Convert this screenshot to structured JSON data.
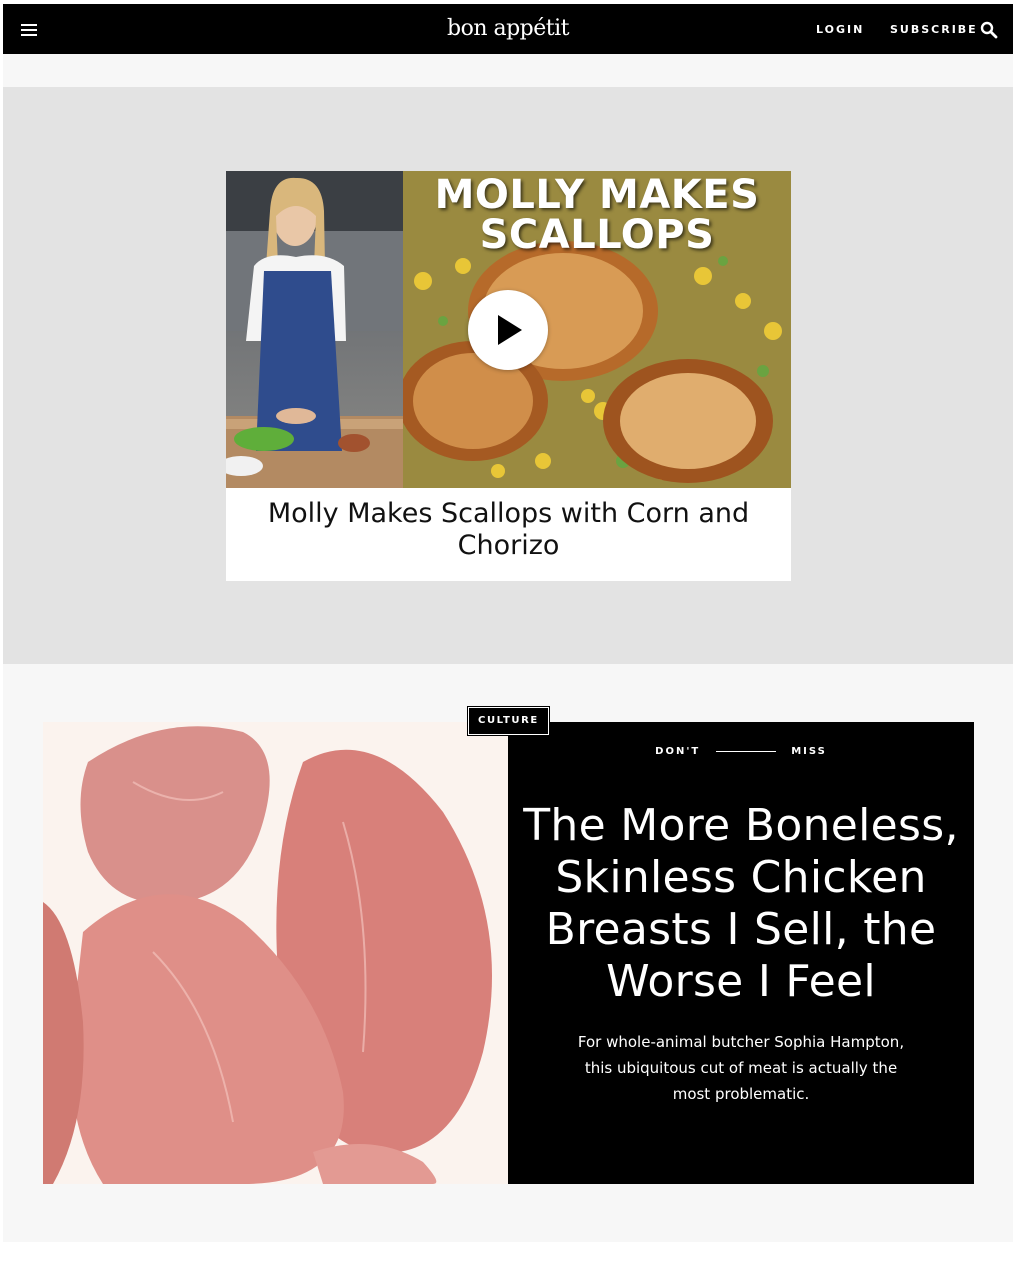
{
  "nav": {
    "logo": "bon appétit",
    "login": "LOGIN",
    "subscribe": "SUBSCRIBE",
    "menu_icon": "hamburger-menu-icon",
    "search_icon": "search-icon",
    "background": "#000000"
  },
  "video": {
    "thumbnail_title_line1": "MOLLY MAKES",
    "thumbnail_title_line2": "SCALLOPS",
    "caption": "Molly Makes Scallops with Corn and Chorizo",
    "play_icon": "play-icon"
  },
  "feature": {
    "tag": "CULTURE",
    "kicker_left": "DON'T",
    "kicker_right": "MISS",
    "headline": "The More Boneless, Skinless Chicken Breasts I Sell, the Worse I Feel",
    "dek": "For whole-animal butcher Sophia Hampton, this ubiquitous cut of meat is actually the most problematic."
  },
  "colors": {
    "band_gray": "#e3e3e3",
    "page_bg": "#f7f7f7",
    "panel_black": "#000000"
  }
}
